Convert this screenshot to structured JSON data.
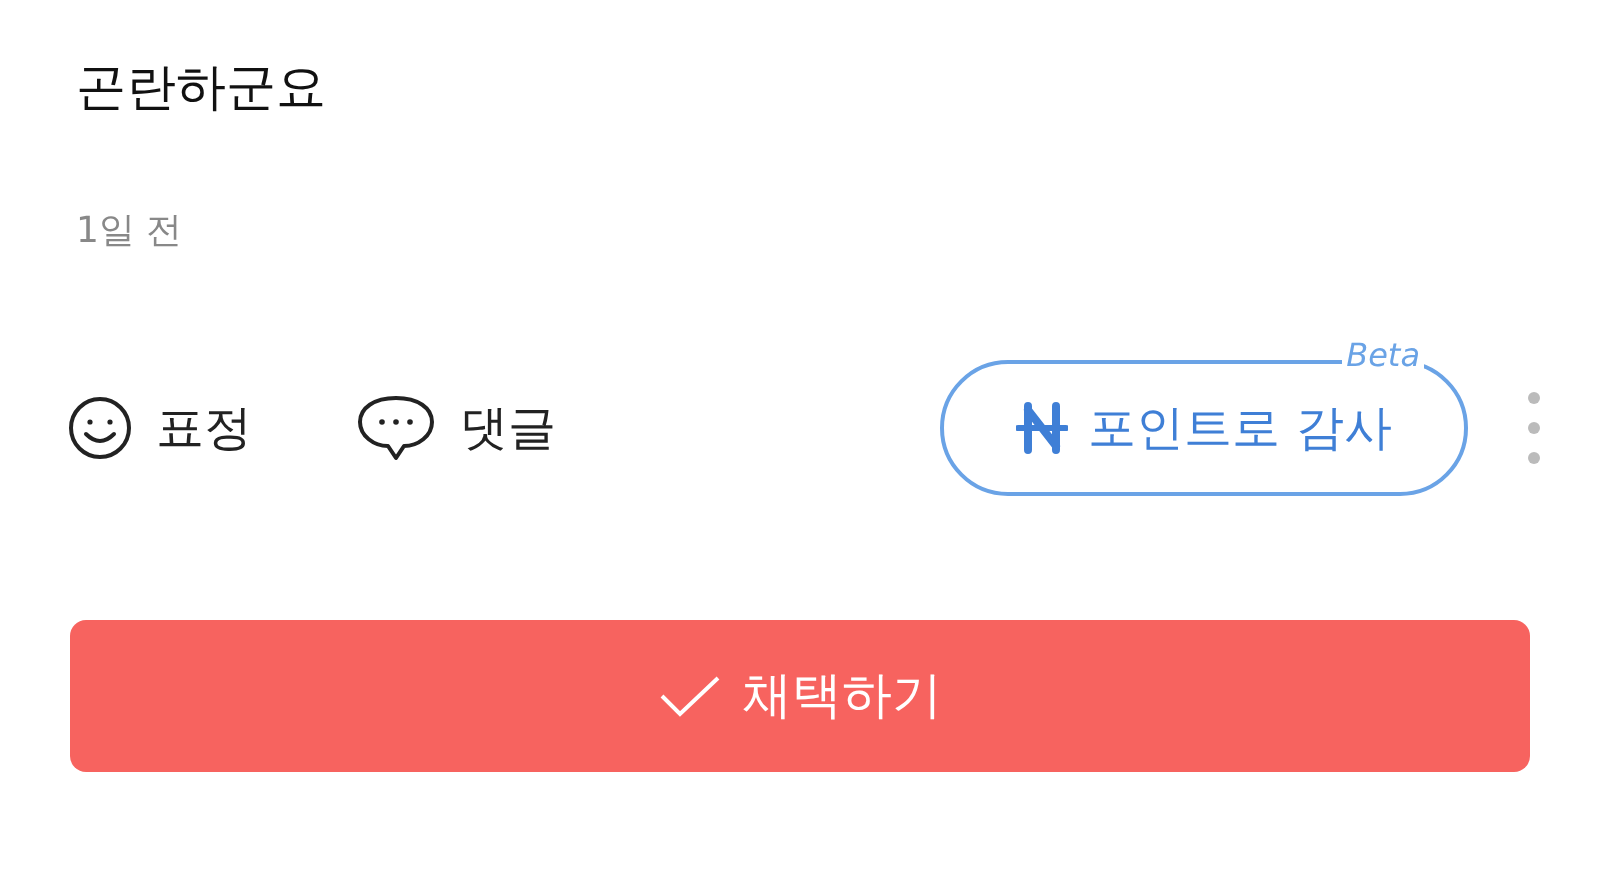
{
  "answer": {
    "text": "곤란하군요",
    "time": "1일 전"
  },
  "actions": [
    {
      "kind": "emoji",
      "label": "표정"
    },
    {
      "kind": "comment",
      "label": "댓글"
    }
  ],
  "thanks_button": {
    "label": "포인트로 감사",
    "badge": "Beta"
  },
  "adopt_button": {
    "label": "채택하기"
  }
}
